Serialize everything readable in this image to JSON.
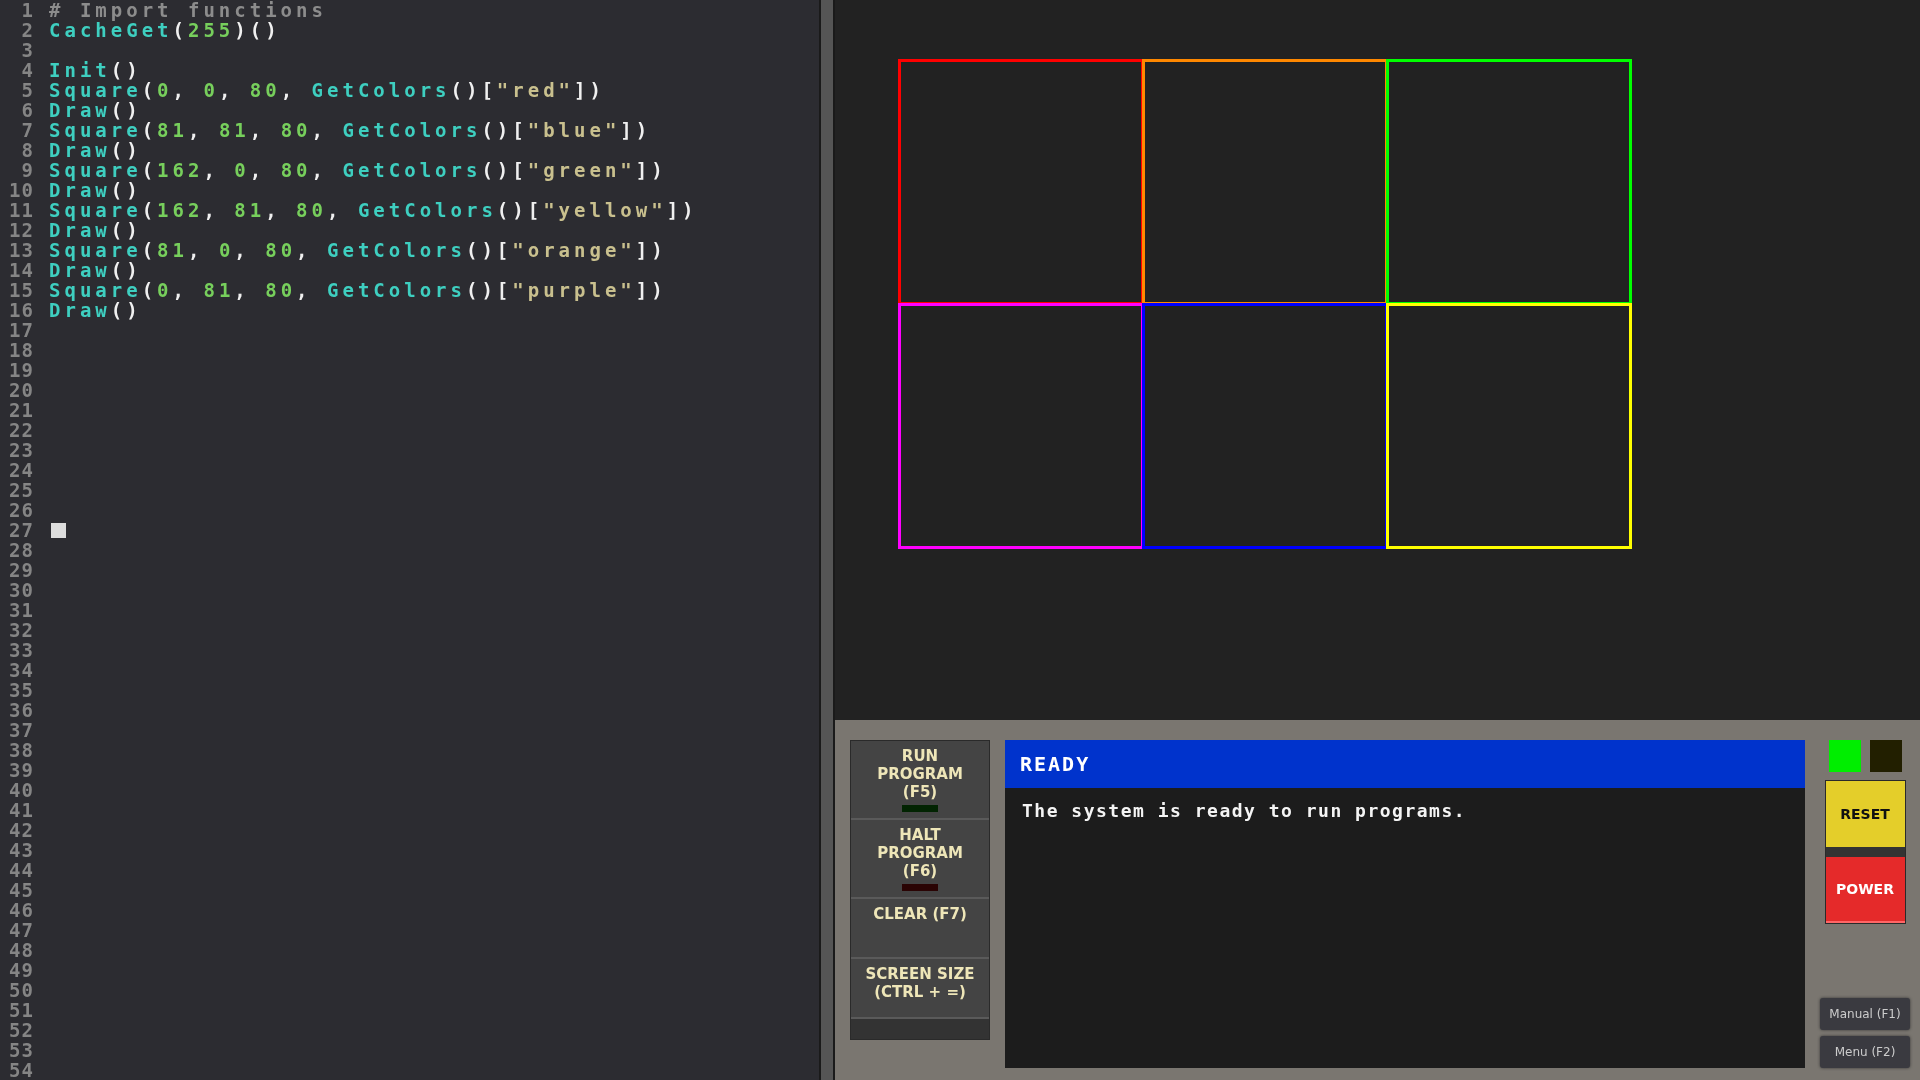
{
  "editor": {
    "lines": [
      {
        "number": "1",
        "tokens": [
          {
            "kind": "comment",
            "text": "# Import functions"
          }
        ]
      },
      {
        "number": "2",
        "tokens": [
          {
            "kind": "func",
            "text": "CacheGet"
          },
          {
            "kind": "punct",
            "text": "("
          },
          {
            "kind": "num",
            "text": "255"
          },
          {
            "kind": "punct",
            "text": ")()"
          }
        ]
      },
      {
        "number": "3"
      },
      {
        "number": "4",
        "tokens": [
          {
            "kind": "func",
            "text": "Init"
          },
          {
            "kind": "punct",
            "text": "()"
          }
        ]
      },
      {
        "number": "5",
        "tokens": [
          {
            "kind": "func",
            "text": "Square"
          },
          {
            "kind": "punct",
            "text": "("
          },
          {
            "kind": "num",
            "text": "0"
          },
          {
            "kind": "punct",
            "text": ", "
          },
          {
            "kind": "num",
            "text": "0"
          },
          {
            "kind": "punct",
            "text": ", "
          },
          {
            "kind": "num",
            "text": "80"
          },
          {
            "kind": "punct",
            "text": ", "
          },
          {
            "kind": "func",
            "text": "GetColors"
          },
          {
            "kind": "punct",
            "text": "()["
          },
          {
            "kind": "str",
            "text": "\"red\""
          },
          {
            "kind": "punct",
            "text": "])"
          }
        ]
      },
      {
        "number": "6",
        "tokens": [
          {
            "kind": "func",
            "text": "Draw"
          },
          {
            "kind": "punct",
            "text": "()"
          }
        ]
      },
      {
        "number": "7",
        "tokens": [
          {
            "kind": "func",
            "text": "Square"
          },
          {
            "kind": "punct",
            "text": "("
          },
          {
            "kind": "num",
            "text": "81"
          },
          {
            "kind": "punct",
            "text": ", "
          },
          {
            "kind": "num",
            "text": "81"
          },
          {
            "kind": "punct",
            "text": ", "
          },
          {
            "kind": "num",
            "text": "80"
          },
          {
            "kind": "punct",
            "text": ", "
          },
          {
            "kind": "func",
            "text": "GetColors"
          },
          {
            "kind": "punct",
            "text": "()["
          },
          {
            "kind": "str",
            "text": "\"blue\""
          },
          {
            "kind": "punct",
            "text": "])"
          }
        ]
      },
      {
        "number": "8",
        "tokens": [
          {
            "kind": "func",
            "text": "Draw"
          },
          {
            "kind": "punct",
            "text": "()"
          }
        ]
      },
      {
        "number": "9",
        "tokens": [
          {
            "kind": "func",
            "text": "Square"
          },
          {
            "kind": "punct",
            "text": "("
          },
          {
            "kind": "num",
            "text": "162"
          },
          {
            "kind": "punct",
            "text": ", "
          },
          {
            "kind": "num",
            "text": "0"
          },
          {
            "kind": "punct",
            "text": ", "
          },
          {
            "kind": "num",
            "text": "80"
          },
          {
            "kind": "punct",
            "text": ", "
          },
          {
            "kind": "func",
            "text": "GetColors"
          },
          {
            "kind": "punct",
            "text": "()["
          },
          {
            "kind": "str",
            "text": "\"green\""
          },
          {
            "kind": "punct",
            "text": "])"
          }
        ]
      },
      {
        "number": "10",
        "tokens": [
          {
            "kind": "func",
            "text": "Draw"
          },
          {
            "kind": "punct",
            "text": "()"
          }
        ]
      },
      {
        "number": "11",
        "tokens": [
          {
            "kind": "func",
            "text": "Square"
          },
          {
            "kind": "punct",
            "text": "("
          },
          {
            "kind": "num",
            "text": "162"
          },
          {
            "kind": "punct",
            "text": ", "
          },
          {
            "kind": "num",
            "text": "81"
          },
          {
            "kind": "punct",
            "text": ", "
          },
          {
            "kind": "num",
            "text": "80"
          },
          {
            "kind": "punct",
            "text": ", "
          },
          {
            "kind": "func",
            "text": "GetColors"
          },
          {
            "kind": "punct",
            "text": "()["
          },
          {
            "kind": "str",
            "text": "\"yellow\""
          },
          {
            "kind": "punct",
            "text": "])"
          }
        ]
      },
      {
        "number": "12",
        "tokens": [
          {
            "kind": "func",
            "text": "Draw"
          },
          {
            "kind": "punct",
            "text": "()"
          }
        ]
      },
      {
        "number": "13",
        "tokens": [
          {
            "kind": "func",
            "text": "Square"
          },
          {
            "kind": "punct",
            "text": "("
          },
          {
            "kind": "num",
            "text": "81"
          },
          {
            "kind": "punct",
            "text": ", "
          },
          {
            "kind": "num",
            "text": "0"
          },
          {
            "kind": "punct",
            "text": ", "
          },
          {
            "kind": "num",
            "text": "80"
          },
          {
            "kind": "punct",
            "text": ", "
          },
          {
            "kind": "func",
            "text": "GetColors"
          },
          {
            "kind": "punct",
            "text": "()["
          },
          {
            "kind": "str",
            "text": "\"orange\""
          },
          {
            "kind": "punct",
            "text": "])"
          }
        ]
      },
      {
        "number": "14",
        "tokens": [
          {
            "kind": "func",
            "text": "Draw"
          },
          {
            "kind": "punct",
            "text": "()"
          }
        ]
      },
      {
        "number": "15",
        "tokens": [
          {
            "kind": "func",
            "text": "Square"
          },
          {
            "kind": "punct",
            "text": "("
          },
          {
            "kind": "num",
            "text": "0"
          },
          {
            "kind": "punct",
            "text": ", "
          },
          {
            "kind": "num",
            "text": "81"
          },
          {
            "kind": "punct",
            "text": ", "
          },
          {
            "kind": "num",
            "text": "80"
          },
          {
            "kind": "punct",
            "text": ", "
          },
          {
            "kind": "func",
            "text": "GetColors"
          },
          {
            "kind": "punct",
            "text": "()["
          },
          {
            "kind": "str",
            "text": "\"purple\""
          },
          {
            "kind": "punct",
            "text": "])"
          }
        ]
      },
      {
        "number": "16",
        "tokens": [
          {
            "kind": "func",
            "text": "Draw"
          },
          {
            "kind": "punct",
            "text": "()"
          }
        ]
      },
      {
        "number": "17"
      },
      {
        "number": "18"
      },
      {
        "number": "19"
      },
      {
        "number": "20"
      },
      {
        "number": "21"
      },
      {
        "number": "22"
      },
      {
        "number": "23"
      },
      {
        "number": "24"
      },
      {
        "number": "25"
      },
      {
        "number": "26"
      },
      {
        "number": "27",
        "cursor": true
      },
      {
        "number": "28"
      },
      {
        "number": "29"
      },
      {
        "number": "30"
      },
      {
        "number": "31"
      },
      {
        "number": "32"
      },
      {
        "number": "33"
      },
      {
        "number": "34"
      },
      {
        "number": "35"
      },
      {
        "number": "36"
      },
      {
        "number": "37"
      },
      {
        "number": "38"
      },
      {
        "number": "39"
      },
      {
        "number": "40"
      },
      {
        "number": "41"
      },
      {
        "number": "42"
      },
      {
        "number": "43"
      },
      {
        "number": "44"
      },
      {
        "number": "45"
      },
      {
        "number": "46"
      },
      {
        "number": "47"
      },
      {
        "number": "48"
      },
      {
        "number": "49"
      },
      {
        "number": "50"
      },
      {
        "number": "51"
      },
      {
        "number": "52"
      },
      {
        "number": "53"
      },
      {
        "number": "54"
      }
    ]
  },
  "canvas": {
    "squares": [
      {
        "color": "#ff0000"
      },
      {
        "color": "#ff8800"
      },
      {
        "color": "#00ff00"
      },
      {
        "color": "#ff00ff"
      },
      {
        "color": "#0000ff"
      },
      {
        "color": "#ffff00"
      }
    ]
  },
  "controls": {
    "buttons": [
      {
        "label": "RUN PROGRAM (F5)",
        "indicator": {
          "color": "#022402"
        }
      },
      {
        "label": "HALT PROGRAM (F6)",
        "indicator": {
          "color": "#2a0404"
        }
      },
      {
        "label": "CLEAR (F7)"
      },
      {
        "label": "SCREEN SIZE (CTRL + =)"
      }
    ]
  },
  "console": {
    "title": "READY",
    "message": "The system is ready to run programs."
  },
  "status_lights": [
    {
      "color": "#00ee00"
    },
    {
      "color": "#221f00"
    }
  ],
  "hardware_buttons": [
    {
      "kind": "reset",
      "label": "RESET"
    },
    {
      "kind": "power",
      "label": "POWER"
    }
  ],
  "menu_buttons": [
    {
      "label": "Manual (F1)"
    },
    {
      "label": "Menu (F2)"
    }
  ]
}
